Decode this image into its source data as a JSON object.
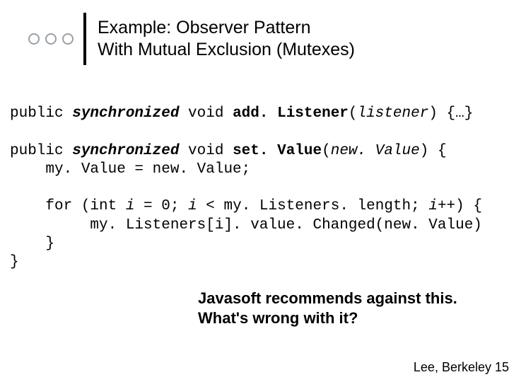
{
  "title": {
    "line1": "Example: Observer Pattern",
    "line2": "With Mutual Exclusion (Mutexes)"
  },
  "code": {
    "l1_public": "public ",
    "l1_sync": "synchronized",
    "l1_void": " void ",
    "l1_fn": "add. Listener",
    "l1_paren_open": "(",
    "l1_arg": "listener",
    "l1_rest": ") {…}",
    "l2_public": "public ",
    "l2_sync": "synchronized",
    "l2_void": " void ",
    "l2_fn": "set. Value",
    "l2_paren_open": "(",
    "l2_arg": "new. Value",
    "l2_rest": ") {",
    "l3": "    my. Value = new. Value;",
    "l4_for": "    for ",
    "l4_int": "(int ",
    "l4_i1": "i",
    "l4_eq": " = 0; ",
    "l4_i2": "i",
    "l4_lt": " < my. Listeners. length; ",
    "l4_i3": "i",
    "l4_pp": "++) {",
    "l5": "         my. Listeners[i]. value. Changed(new. Value)",
    "l6": "    }",
    "l7": "}"
  },
  "note": {
    "line1": "Javasoft recommends against this.",
    "line2": "What's wrong with it?"
  },
  "footer": "Lee, Berkeley 15"
}
